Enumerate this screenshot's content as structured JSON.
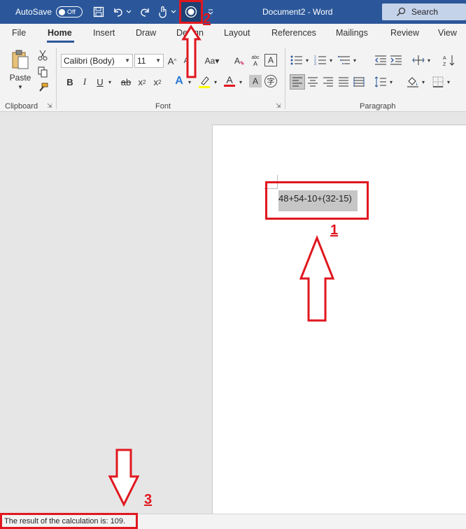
{
  "titlebar": {
    "autosave_label": "AutoSave",
    "autosave_state": "Off",
    "doc_title": "Document2  -  Word",
    "search_label": "Search"
  },
  "tabs": [
    {
      "label": "File"
    },
    {
      "label": "Home"
    },
    {
      "label": "Insert"
    },
    {
      "label": "Draw"
    },
    {
      "label": "Design"
    },
    {
      "label": "Layout"
    },
    {
      "label": "References"
    },
    {
      "label": "Mailings"
    },
    {
      "label": "Review"
    },
    {
      "label": "View"
    }
  ],
  "ribbon": {
    "clipboard": {
      "paste_label": "Paste",
      "group_label": "Clipboard"
    },
    "font": {
      "font_name": "Calibri (Body)",
      "font_size": "11",
      "group_label": "Font"
    },
    "paragraph": {
      "group_label": "Paragraph"
    }
  },
  "document": {
    "expression": "48+54-10+(32-15)"
  },
  "status": {
    "message": "The result of the calculation is: 109."
  },
  "annotations": {
    "n1": "1",
    "n2": "2",
    "n3": "3",
    "color": "#e0171f"
  },
  "colors": {
    "accent": "#2b579a",
    "ribbon_bg": "#f3f3f3",
    "selection": "#c6c6c6"
  }
}
